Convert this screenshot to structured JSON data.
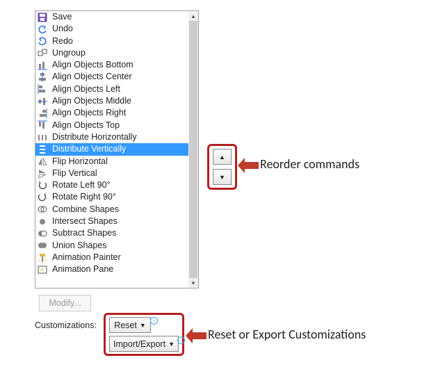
{
  "list": {
    "items": [
      {
        "icon": "save-icon",
        "label": "Save",
        "selected": false
      },
      {
        "icon": "undo-icon",
        "label": "Undo",
        "selected": false,
        "has_dropdown": true
      },
      {
        "icon": "redo-icon",
        "label": "Redo",
        "selected": false
      },
      {
        "icon": "ungroup-icon",
        "label": "Ungroup",
        "selected": false
      },
      {
        "icon": "align-bottom-icon",
        "label": "Align Objects Bottom",
        "selected": false
      },
      {
        "icon": "align-center-icon",
        "label": "Align Objects Center",
        "selected": false
      },
      {
        "icon": "align-left-icon",
        "label": "Align Objects Left",
        "selected": false
      },
      {
        "icon": "align-middle-icon",
        "label": "Align Objects Middle",
        "selected": false
      },
      {
        "icon": "align-right-icon",
        "label": "Align Objects Right",
        "selected": false
      },
      {
        "icon": "align-top-icon",
        "label": "Align Objects Top",
        "selected": false
      },
      {
        "icon": "distribute-horizontal-icon",
        "label": "Distribute Horizontally",
        "selected": false
      },
      {
        "icon": "distribute-vertical-icon",
        "label": "Distribute Vertically",
        "selected": true
      },
      {
        "icon": "flip-horizontal-icon",
        "label": "Flip Horizontal",
        "selected": false
      },
      {
        "icon": "flip-vertical-icon",
        "label": "Flip Vertical",
        "selected": false
      },
      {
        "icon": "rotate-left-icon",
        "label": "Rotate Left 90°",
        "selected": false
      },
      {
        "icon": "rotate-right-icon",
        "label": "Rotate Right 90°",
        "selected": false
      },
      {
        "icon": "combine-shapes-icon",
        "label": "Combine Shapes",
        "selected": false
      },
      {
        "icon": "intersect-shapes-icon",
        "label": "Intersect Shapes",
        "selected": false
      },
      {
        "icon": "subtract-shapes-icon",
        "label": "Subtract Shapes",
        "selected": false
      },
      {
        "icon": "union-shapes-icon",
        "label": "Union Shapes",
        "selected": false
      },
      {
        "icon": "animation-painter-icon",
        "label": "Animation Painter",
        "selected": false
      },
      {
        "icon": "animation-pane-icon",
        "label": "Animation Pane",
        "selected": false
      }
    ]
  },
  "buttons": {
    "modify": "Modify...",
    "reset": "Reset",
    "import_export": "Import/Export"
  },
  "labels": {
    "customizations": "Customizations:"
  },
  "callouts": {
    "reorder": "Reorder commands",
    "reset_export": "Reset or Export Customizations"
  },
  "colors": {
    "selection": "#3399ff",
    "callout_border": "#b41f1f"
  }
}
